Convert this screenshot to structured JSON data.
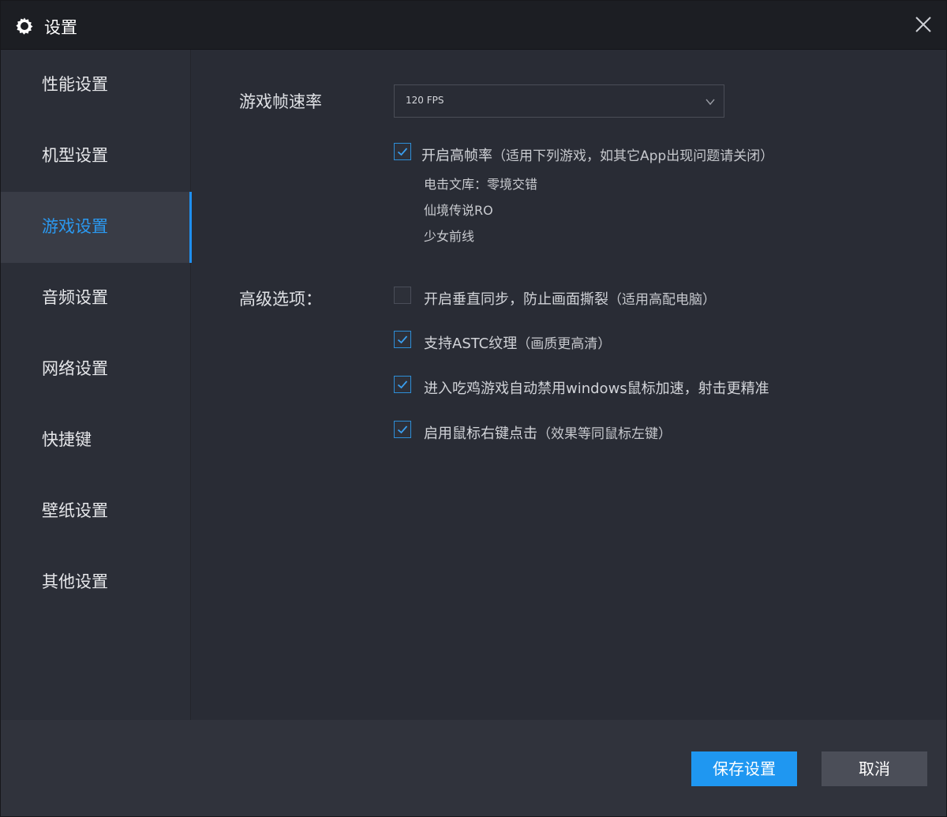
{
  "window": {
    "title": "设置",
    "title_icon": "gear-icon",
    "close_icon": "close-icon"
  },
  "sidebar": {
    "active_index": 2,
    "items": [
      {
        "label": "性能设置"
      },
      {
        "label": "机型设置"
      },
      {
        "label": "游戏设置"
      },
      {
        "label": "音频设置"
      },
      {
        "label": "网络设置"
      },
      {
        "label": "快捷键"
      },
      {
        "label": "壁纸设置"
      },
      {
        "label": "其他设置"
      }
    ]
  },
  "main": {
    "fps_label": "游戏帧速率",
    "fps_select": {
      "value": "120 FPS",
      "icon": "chevron-down-icon"
    },
    "high_fps": {
      "checked": true,
      "label": "开启高帧率",
      "note": "（适用下列游戏，如其它App出现问题请关闭）",
      "games": [
        "电击文库：零境交错",
        "仙境传说RO",
        "少女前线"
      ]
    },
    "advanced_label": "高级选项：",
    "options": [
      {
        "checked": false,
        "label": "开启垂直同步，防止画面撕裂",
        "note": "（适用高配电脑）"
      },
      {
        "checked": true,
        "label": "支持ASTC纹理",
        "note": "（画质更高清）"
      },
      {
        "checked": true,
        "label": "进入吃鸡游戏自动禁用windows鼠标加速，射击更精准",
        "note": ""
      },
      {
        "checked": true,
        "label": "启用鼠标右键点击",
        "note": "（效果等同鼠标左键）"
      }
    ]
  },
  "footer": {
    "save_label": "保存设置",
    "cancel_label": "取消"
  },
  "colors": {
    "accent": "#1f97f1",
    "background": "#292c35",
    "titlebar": "#1c1e23"
  }
}
